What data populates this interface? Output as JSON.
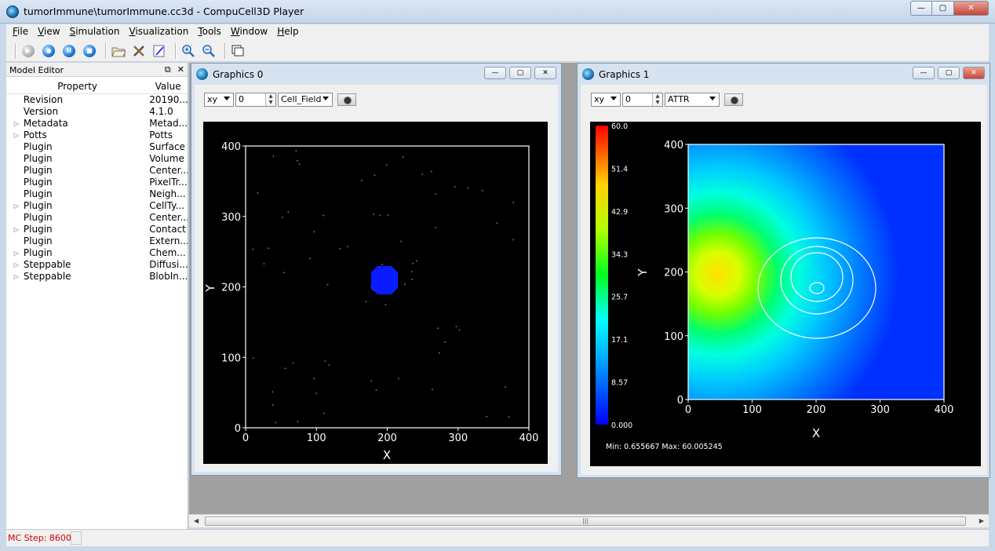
{
  "window": {
    "title": "tumorImmune\\tumorImmune.cc3d - CompuCell3D Player",
    "min": "—",
    "max": "▢",
    "close": "✕"
  },
  "menu": [
    {
      "label": "File",
      "u": "F",
      "rest": "ile"
    },
    {
      "label": "View",
      "u": "V",
      "rest": "iew"
    },
    {
      "label": "Simulation",
      "u": "S",
      "rest": "imulation"
    },
    {
      "label": "Visualization",
      "u": "V",
      "rest": "isualization"
    },
    {
      "label": "Tools",
      "u": "T",
      "rest": "ools"
    },
    {
      "label": "Window",
      "u": "W",
      "rest": "indow"
    },
    {
      "label": "Help",
      "u": "H",
      "rest": "elp"
    }
  ],
  "toolbar_icons": [
    "run-icon",
    "step-icon",
    "pause-icon",
    "stop-icon",
    "open-folder-icon",
    "tools-icon",
    "edit-icon",
    "zoom-in-icon",
    "zoom-out-icon",
    "new-window-icon"
  ],
  "model_editor": {
    "title": "Model Editor",
    "header": {
      "property": "Property",
      "value": "Value"
    },
    "rows": [
      {
        "exp": "",
        "prop": "Revision",
        "val": "20190..."
      },
      {
        "exp": "",
        "prop": "Version",
        "val": "4.1.0"
      },
      {
        "exp": "▷",
        "prop": "Metadata",
        "val": "Metad..."
      },
      {
        "exp": "▷",
        "prop": "Potts",
        "val": "Potts"
      },
      {
        "exp": "",
        "prop": "Plugin",
        "val": "Surface"
      },
      {
        "exp": "",
        "prop": "Plugin",
        "val": "Volume"
      },
      {
        "exp": "",
        "prop": "Plugin",
        "val": "Center..."
      },
      {
        "exp": "",
        "prop": "Plugin",
        "val": "PixelTr..."
      },
      {
        "exp": "",
        "prop": "Plugin",
        "val": "Neigh..."
      },
      {
        "exp": "▷",
        "prop": "Plugin",
        "val": "CellTy..."
      },
      {
        "exp": "",
        "prop": "Plugin",
        "val": "Center..."
      },
      {
        "exp": "▷",
        "prop": "Plugin",
        "val": "Contact"
      },
      {
        "exp": "",
        "prop": "Plugin",
        "val": "Extern..."
      },
      {
        "exp": "▷",
        "prop": "Plugin",
        "val": "Chem..."
      },
      {
        "exp": "▷",
        "prop": "Steppable",
        "val": "Diffusi..."
      },
      {
        "exp": "▷",
        "prop": "Steppable",
        "val": "BlobIn..."
      }
    ]
  },
  "graphics0": {
    "title": "Graphics 0",
    "plane": "xy",
    "slice": "0",
    "field": "Cell_Field",
    "x_ticks": [
      "0",
      "100",
      "200",
      "300",
      "400"
    ],
    "y_ticks": [
      "0",
      "100",
      "200",
      "300",
      "400"
    ],
    "xlabel": "X",
    "ylabel": "Y"
  },
  "graphics1": {
    "title": "Graphics 1",
    "plane": "xy",
    "slice": "0",
    "field": "ATTR",
    "x_ticks": [
      "0",
      "100",
      "200",
      "300",
      "400"
    ],
    "y_ticks": [
      "0",
      "100",
      "200",
      "300",
      "400"
    ],
    "xlabel": "X",
    "ylabel": "Y",
    "colorbar_labels": [
      "60.0",
      "51.4",
      "42.9",
      "34.3",
      "25.7",
      "17.1",
      "8.57",
      "0.000"
    ],
    "minmax": "Min: 0.655667 Max: 60.005245"
  },
  "status": {
    "mc_step": "MC Step: 8600"
  },
  "scrollbar": {
    "grip": "|||",
    "left": "◀",
    "right": "▶"
  }
}
